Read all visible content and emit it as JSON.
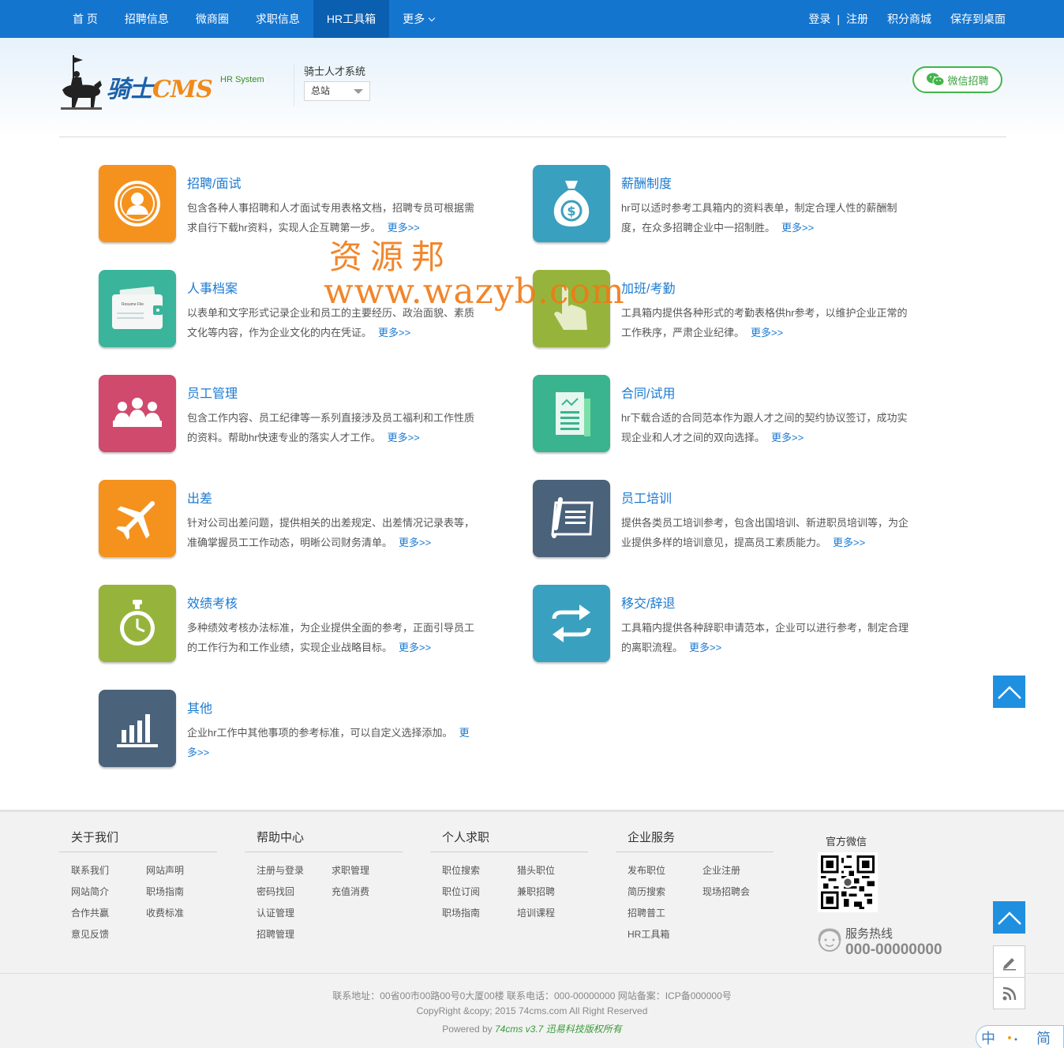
{
  "nav": {
    "items": [
      "首 页",
      "招聘信息",
      "微商圈",
      "求职信息",
      "HR工具箱",
      "更多"
    ],
    "active_index": 4,
    "login": "登录",
    "separator": "|",
    "register": "注册",
    "points_mall": "积分商城",
    "save_desktop": "保存到桌面"
  },
  "header": {
    "logo_brand": "骑士",
    "logo_cms": "CMS",
    "logo_sub": "HR System",
    "site_name": "骑士人才系统",
    "site_select": "总站",
    "wechat_button": "微信招聘"
  },
  "watermark": {
    "line1": "资源邦",
    "line2": "www.wazyb.com"
  },
  "tools": [
    {
      "title": "招聘/面试",
      "desc": "包含各种人事招聘和人才面试专用表格文档，招聘专员可根据需求自行下载hr资料，实现人企互聘第一步。",
      "more": "更多>>",
      "color": "#f5921e",
      "icon": "interview-icon"
    },
    {
      "title": "薪酬制度",
      "desc": "hr可以适时参考工具箱内的资料表单，制定合理人性的薪酬制度，在众多招聘企业中一招制胜。",
      "more": "更多>>",
      "color": "#3aa0c0",
      "icon": "money-bag-icon"
    },
    {
      "title": "人事档案",
      "desc": "以表单和文字形式记录企业和员工的主要经历、政治面貌、素质文化等内容，作为企业文化的内在凭证。",
      "more": "更多>>",
      "color": "#3ab49b",
      "icon": "resume-file-icon",
      "icon_text": "Resume File"
    },
    {
      "title": "加班/考勤",
      "desc": "工具箱内提供各种形式的考勤表格供hr参考，以维护企业正常的工作秩序，严肃企业纪律。",
      "more": "更多>>",
      "color": "#96b43c",
      "icon": "hand-pointer-icon"
    },
    {
      "title": "员工管理",
      "desc": "包含工作内容、员工纪律等一系列直接涉及员工福利和工作性质的资料。帮助hr快速专业的落实人才工作。",
      "more": "更多>>",
      "color": "#d04a6e",
      "icon": "team-icon"
    },
    {
      "title": "合同/试用",
      "desc": "hr下载合适的合同范本作为跟人才之间的契约协议签订，成功实现企业和人才之间的双向选择。",
      "more": "更多>>",
      "color": "#3ab48e",
      "icon": "contract-icon"
    },
    {
      "title": "出差",
      "desc": "针对公司出差问题，提供相关的出差规定、出差情况记录表等，准确掌握员工工作动态，明晰公司财务清单。",
      "more": "更多>>",
      "color": "#f5921e",
      "icon": "airplane-icon"
    },
    {
      "title": "员工培训",
      "desc": "提供各类员工培训参考，包含出国培训、新进职员培训等，为企业提供多样的培训意见，提高员工素质能力。",
      "more": "更多>>",
      "color": "#4a627a",
      "icon": "training-document-icon"
    },
    {
      "title": "效绩考核",
      "desc": "多种绩效考核办法标准，为企业提供全面的参考，正面引导员工的工作行为和工作业绩，实现企业战略目标。",
      "more": "更多>>",
      "color": "#96b43c",
      "icon": "stopwatch-icon"
    },
    {
      "title": "移交/辞退",
      "desc": "工具箱内提供各种辞职申请范本，企业可以进行参考，制定合理的离职流程。",
      "more": "更多>>",
      "color": "#3aa0c0",
      "icon": "exchange-arrows-icon"
    },
    {
      "title": "其他",
      "desc": "企业hr工作中其他事项的参考标准，可以自定义选择添加。",
      "more": "更多>>",
      "color": "#4a627a",
      "icon": "bar-chart-icon"
    }
  ],
  "footer": {
    "columns": [
      {
        "title": "关于我们",
        "links": [
          "联系我们",
          "网站声明",
          "网站简介",
          "职场指南",
          "合作共赢",
          "收费标准",
          "意见反馈"
        ]
      },
      {
        "title": "帮助中心",
        "links": [
          "注册与登录",
          "求职管理",
          "密码找回",
          "充值消费",
          "认证管理",
          "",
          "招聘管理"
        ]
      },
      {
        "title": "个人求职",
        "links": [
          "职位搜索",
          "猎头职位",
          "职位订阅",
          "兼职招聘",
          "职场指南",
          "培训课程"
        ]
      },
      {
        "title": "企业服务",
        "links": [
          "发布职位",
          "企业注册",
          "简历搜索",
          "现场招聘会",
          "招聘普工",
          "",
          "HR工具箱"
        ]
      }
    ],
    "wechat_title": "官方微信",
    "hotline_label": "服务热线",
    "hotline_number": "000-00000000",
    "address_line": "联系地址：00省00市00路00号0大厦00楼 联系电话：000-00000000 网站备案：ICP备000000号",
    "copyright": "CopyRight &copy; 2015 74cms.com All Right Reserved",
    "powered_prefix": "Powered by",
    "powered_product": "74cms v3.7",
    "powered_company": "迅易科技版权所有"
  },
  "lang_switch": {
    "left": "中",
    "right": "简"
  }
}
